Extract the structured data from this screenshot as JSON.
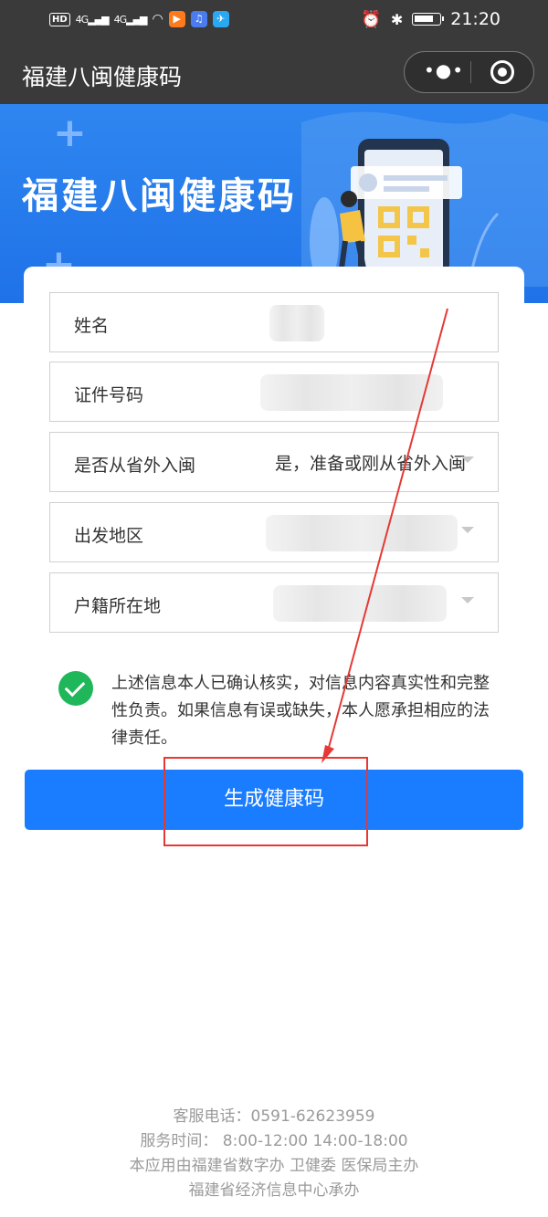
{
  "status_bar": {
    "network_hd": "HD",
    "sim1": "4G",
    "sim2": "4G",
    "time": "21:20"
  },
  "title_bar": {
    "title": "福建八闽健康码",
    "more_icon": "more-dots-icon",
    "close_icon": "target-close-icon"
  },
  "banner": {
    "title": "福建八闽健康码"
  },
  "form": {
    "fields": [
      {
        "label": "姓名",
        "value": ""
      },
      {
        "label": "证件号码",
        "value": ""
      },
      {
        "label": "是否从省外入闽",
        "value": "是，准备或刚从省外入闽"
      },
      {
        "label": "出发地区",
        "value": ""
      },
      {
        "label": "户籍所在地",
        "value": ""
      }
    ],
    "consent_text": "上述信息本人已确认核实，对信息内容真实性和完整性负责。如果信息有误或缺失，本人愿承担相应的法律责任。",
    "submit_label": "生成健康码"
  },
  "footer": {
    "line1": "客服电话：0591-62623959",
    "line2": "服务时间：  8:00-12:00 14:00-18:00",
    "line3": "本应用由福建省数字办  卫健委  医保局主办",
    "line4": "福建省经济信息中心承办"
  },
  "colors": {
    "primary_blue": "#1a7cff",
    "banner_blue": "#2f86f0",
    "check_green": "#20b65a",
    "annotation_red": "#e53935"
  }
}
